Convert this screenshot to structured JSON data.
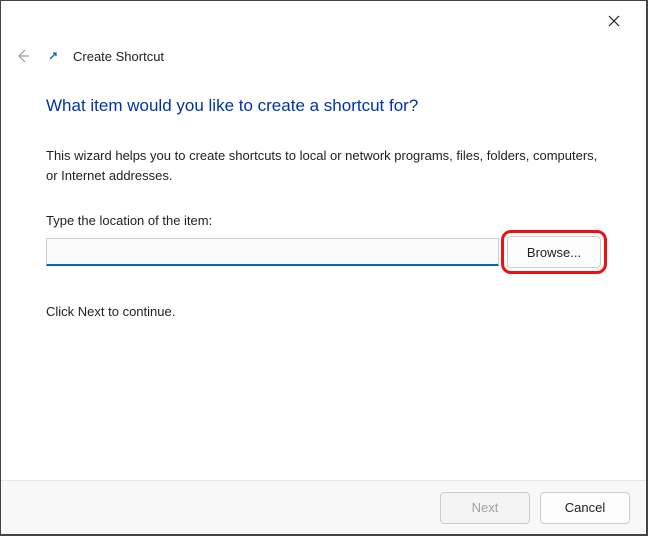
{
  "window": {
    "wizard_title": "Create Shortcut"
  },
  "content": {
    "heading": "What item would you like to create a shortcut for?",
    "description": "This wizard helps you to create shortcuts to local or network programs, files, folders, computers, or Internet addresses.",
    "input_label": "Type the location of the item:",
    "input_value": "",
    "browse_label": "Browse...",
    "continue_hint": "Click Next to continue."
  },
  "footer": {
    "next_label": "Next",
    "cancel_label": "Cancel"
  }
}
